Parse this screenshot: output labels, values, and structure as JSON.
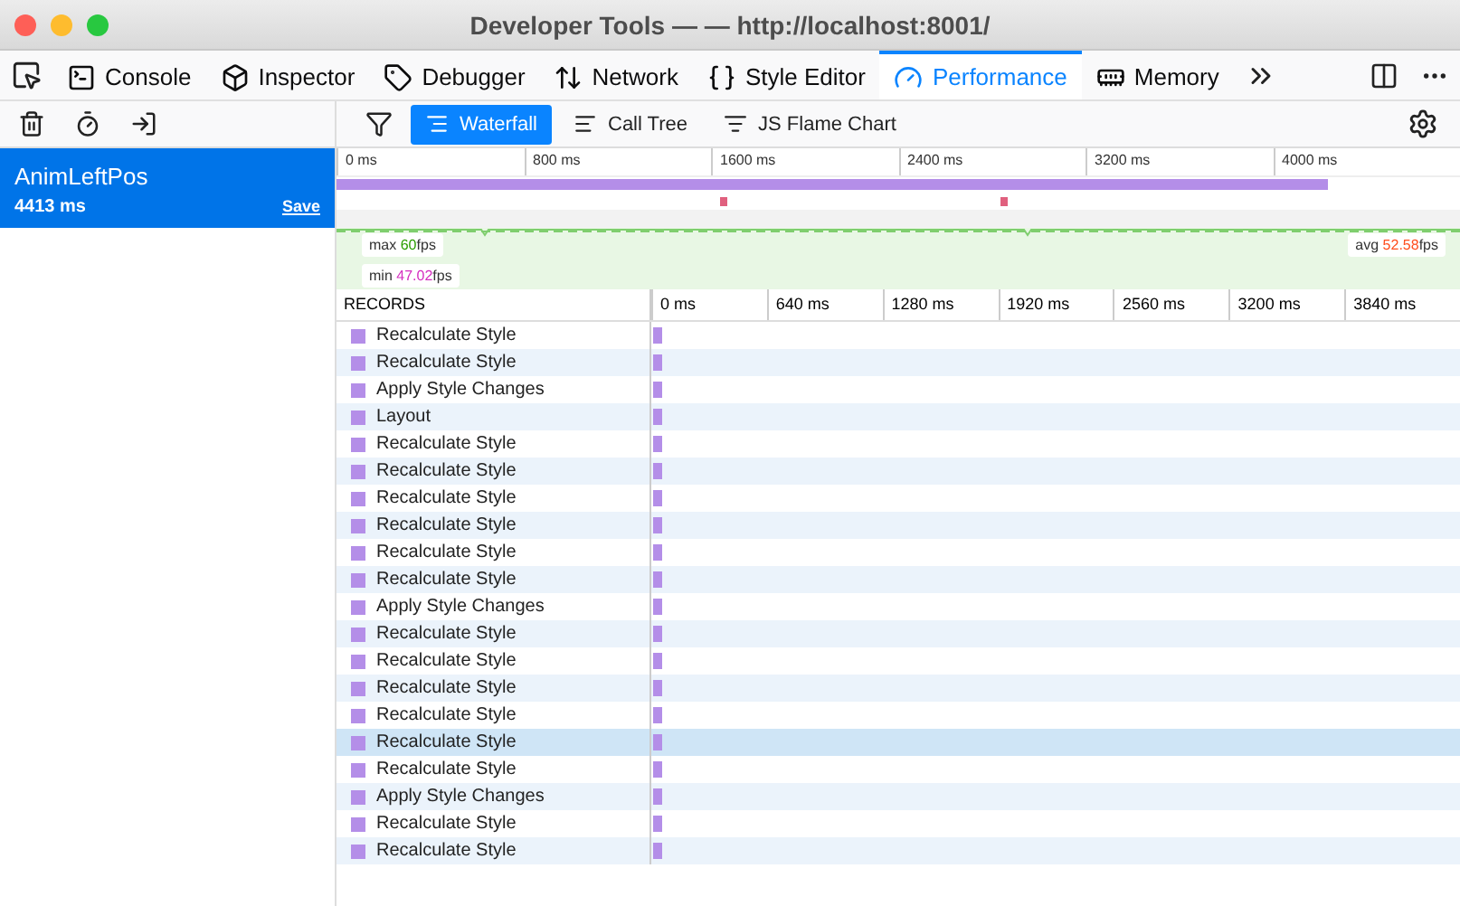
{
  "window": {
    "title": "Developer Tools —  — http://localhost:8001/"
  },
  "tabs": [
    {
      "label": "Console",
      "selected": false
    },
    {
      "label": "Inspector",
      "selected": false
    },
    {
      "label": "Debugger",
      "selected": false
    },
    {
      "label": "Network",
      "selected": false
    },
    {
      "label": "Style Editor",
      "selected": false
    },
    {
      "label": "Performance",
      "selected": true
    },
    {
      "label": "Memory",
      "selected": false
    }
  ],
  "views": [
    {
      "label": "Waterfall",
      "selected": true
    },
    {
      "label": "Call Tree",
      "selected": false
    },
    {
      "label": "JS Flame Chart",
      "selected": false
    }
  ],
  "recordings": [
    {
      "name": "AnimLeftPos",
      "duration": "4413 ms",
      "save": "Save",
      "selected": true
    }
  ],
  "overview": {
    "ticks": [
      "0 ms",
      "800 ms",
      "1600 ms",
      "2400 ms",
      "3200 ms",
      "4000 ms"
    ],
    "fps": [
      {
        "kind": "max",
        "label": "max",
        "value": "60",
        "unit": "fps"
      },
      {
        "kind": "min",
        "label": "min",
        "value": "47.02",
        "unit": "fps"
      },
      {
        "kind": "avg",
        "label": "avg",
        "value": "52.58",
        "unit": "fps"
      }
    ]
  },
  "records": {
    "header": "RECORDS",
    "ticks": [
      "0 ms",
      "640 ms",
      "1280 ms",
      "1920 ms",
      "2560 ms",
      "3200 ms",
      "3840 ms"
    ],
    "rows": [
      {
        "name": "Recalculate Style",
        "selected": false
      },
      {
        "name": "Recalculate Style",
        "selected": false
      },
      {
        "name": "Apply Style Changes",
        "selected": false
      },
      {
        "name": "Layout",
        "selected": false
      },
      {
        "name": "Recalculate Style",
        "selected": false
      },
      {
        "name": "Recalculate Style",
        "selected": false
      },
      {
        "name": "Recalculate Style",
        "selected": false
      },
      {
        "name": "Recalculate Style",
        "selected": false
      },
      {
        "name": "Recalculate Style",
        "selected": false
      },
      {
        "name": "Recalculate Style",
        "selected": false
      },
      {
        "name": "Apply Style Changes",
        "selected": false
      },
      {
        "name": "Recalculate Style",
        "selected": false
      },
      {
        "name": "Recalculate Style",
        "selected": false
      },
      {
        "name": "Recalculate Style",
        "selected": false
      },
      {
        "name": "Recalculate Style",
        "selected": false
      },
      {
        "name": "Recalculate Style",
        "selected": true
      },
      {
        "name": "Recalculate Style",
        "selected": false
      },
      {
        "name": "Apply Style Changes",
        "selected": false
      },
      {
        "name": "Recalculate Style",
        "selected": false
      },
      {
        "name": "Recalculate Style",
        "selected": false
      }
    ]
  }
}
